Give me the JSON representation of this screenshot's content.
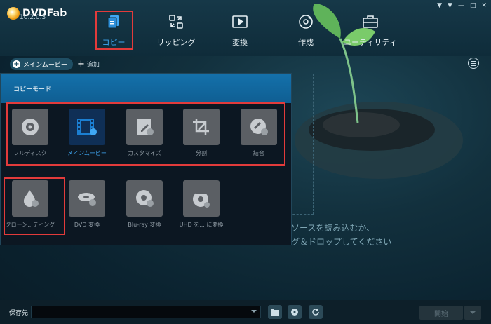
{
  "app": {
    "name": "DVDFab",
    "version": "10.2.0.3"
  },
  "nav": [
    {
      "id": "copy",
      "label": "コピー",
      "icon": "copy-icon",
      "active": true
    },
    {
      "id": "ripper",
      "label": "リッピング",
      "icon": "ripper-icon",
      "active": false
    },
    {
      "id": "convert",
      "label": "変換",
      "icon": "video-convert-icon",
      "active": false
    },
    {
      "id": "create",
      "label": "作成",
      "icon": "disc-create-icon",
      "active": false
    },
    {
      "id": "utility",
      "label": "ユーティリティ",
      "icon": "toolbox-icon",
      "active": false
    }
  ],
  "subbar": {
    "mode_button": "メインムービー",
    "add_label": "追加"
  },
  "panel": {
    "title": "コピーモード",
    "modes": [
      {
        "label": "フルディスク",
        "icon": "disc-icon",
        "selected": false
      },
      {
        "label": "メインムービー",
        "icon": "film-icon",
        "selected": true
      },
      {
        "label": "カスタマイズ",
        "icon": "customize-edit-icon",
        "selected": false
      },
      {
        "label": "分割",
        "icon": "split-crop-icon",
        "selected": false
      },
      {
        "label": "結合",
        "icon": "merge-link-icon",
        "selected": false
      },
      {
        "label": "クローン...ティング",
        "icon": "clone-burn-icon",
        "selected": false
      },
      {
        "label": "DVD 変換",
        "icon": "dvd-convert-icon",
        "selected": false
      },
      {
        "label": "Blu-ray 変換",
        "icon": "bluray-convert-icon",
        "selected": false
      },
      {
        "label": "UHD を... に変換",
        "icon": "uhd-convert-icon",
        "selected": false
      }
    ]
  },
  "hint": {
    "line1": "ソースを読み込むか、",
    "line2": "グ＆ドロップしてください"
  },
  "bottom": {
    "save_label": "保存先:",
    "save_value": "",
    "start_label": "開始"
  },
  "colors": {
    "accent": "#3fa8f5",
    "highlight": "#e23b3b",
    "panel_header": "#1471ab"
  }
}
